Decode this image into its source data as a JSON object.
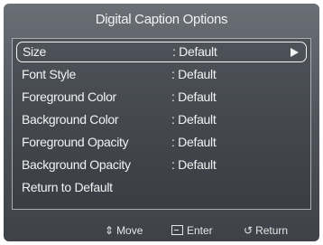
{
  "title": "Digital Caption Options",
  "menu": {
    "items": [
      {
        "label": "Size",
        "value": ": Default"
      },
      {
        "label": "Font Style",
        "value": ": Default"
      },
      {
        "label": "Foreground Color",
        "value": ": Default"
      },
      {
        "label": "Background Color",
        "value": ": Default"
      },
      {
        "label": "Foreground Opacity",
        "value": ": Default"
      },
      {
        "label": "Background Opacity",
        "value": ": Default"
      },
      {
        "label": "Return to Default",
        "value": ""
      }
    ],
    "selected_index": 0
  },
  "footer": {
    "move": {
      "icon": "up-down-arrow-icon",
      "label": "Move",
      "glyph": "⇕"
    },
    "enter": {
      "icon": "enter-icon",
      "label": "Enter"
    },
    "return": {
      "icon": "return-icon",
      "label": "Return",
      "glyph": "↺"
    }
  }
}
